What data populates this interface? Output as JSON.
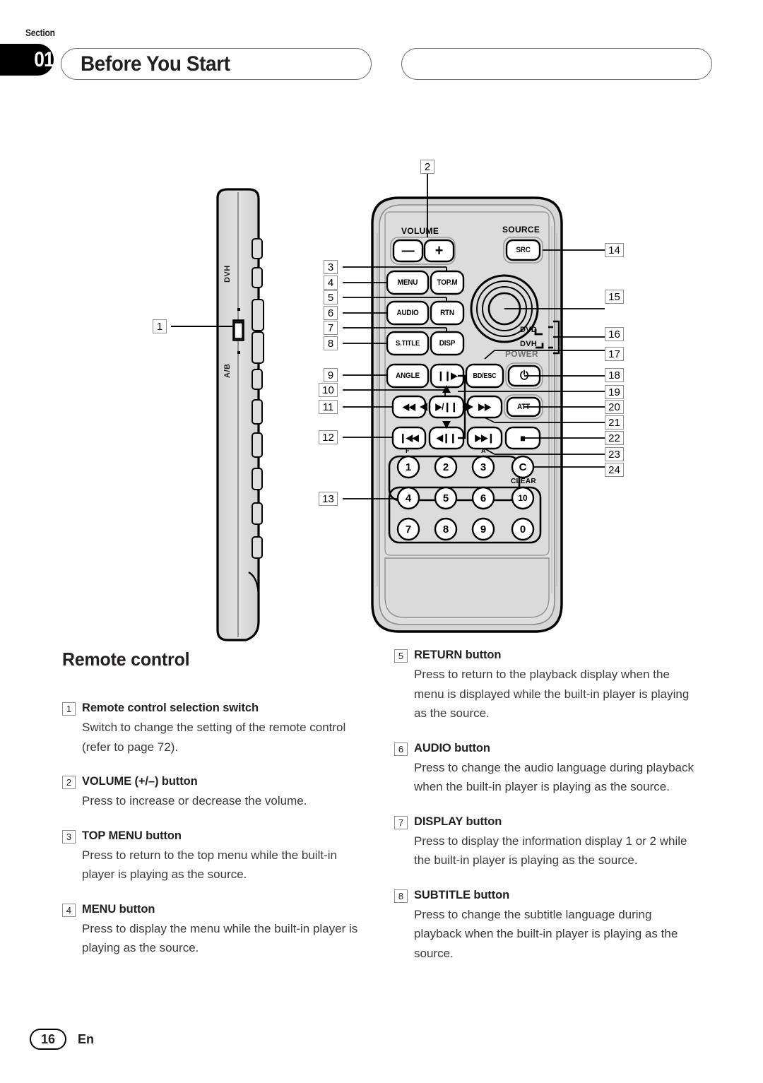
{
  "header": {
    "section_word": "Section",
    "section_number": "01",
    "title": "Before You Start"
  },
  "footer": {
    "page_number": "16",
    "language": "En"
  },
  "diagram": {
    "side_view": {
      "switch_top_label": "DVH",
      "switch_bottom_label": "A/B",
      "callout": "1"
    },
    "remote": {
      "group_labels": {
        "volume": "VOLUME",
        "source": "SOURCE",
        "power": "POWER",
        "clear": "CLEAR",
        "dvd": "DVD",
        "dvh": "DVH",
        "fwd_mark": "F",
        "rev_mark": "A"
      },
      "buttons": [
        {
          "id": "vol-minus",
          "label": "—"
        },
        {
          "id": "vol-plus",
          "label": "+"
        },
        {
          "id": "src",
          "label": "SRC"
        },
        {
          "id": "menu",
          "label": "MENU"
        },
        {
          "id": "top-menu",
          "label": "TOP.M"
        },
        {
          "id": "audio",
          "label": "AUDIO"
        },
        {
          "id": "rtn",
          "label": "RTN"
        },
        {
          "id": "s-title",
          "label": "S.TITLE"
        },
        {
          "id": "disp",
          "label": "DISP"
        },
        {
          "id": "angle",
          "label": "ANGLE"
        },
        {
          "id": "frame-adv",
          "label": "❙❙▶"
        },
        {
          "id": "bd-esc",
          "label": "BD/ESC"
        },
        {
          "id": "power",
          "label": "⏻"
        },
        {
          "id": "rewind",
          "label": "◀◀"
        },
        {
          "id": "play-pause",
          "label": "▶/❙❙"
        },
        {
          "id": "fast-forward",
          "label": "▶▶"
        },
        {
          "id": "att",
          "label": "ATT"
        },
        {
          "id": "prev-track",
          "label": "❙◀◀"
        },
        {
          "id": "slow-rev",
          "label": "◀❙❙"
        },
        {
          "id": "next-track",
          "label": "▶▶❙"
        },
        {
          "id": "stop",
          "label": "■"
        },
        {
          "id": "clear",
          "label": "C"
        }
      ],
      "keypad": [
        "1",
        "2",
        "3",
        "4",
        "5",
        "6",
        "7",
        "8",
        "9",
        "10",
        "0"
      ]
    },
    "callouts": [
      "1",
      "2",
      "3",
      "4",
      "5",
      "6",
      "7",
      "8",
      "9",
      "10",
      "11",
      "12",
      "13",
      "14",
      "15",
      "16",
      "17",
      "18",
      "19",
      "20",
      "21",
      "22",
      "23",
      "24"
    ]
  },
  "content": {
    "section_heading": "Remote control",
    "left_items": [
      {
        "num": "1",
        "title": "Remote control selection switch",
        "body": "Switch to change the setting of the remote control (refer to page 72)."
      },
      {
        "num": "2",
        "title": "VOLUME (+/–) button",
        "body": "Press to increase or decrease the volume."
      },
      {
        "num": "3",
        "title": "TOP MENU button",
        "body": "Press to return to the top menu while the built-in player is playing as the source."
      },
      {
        "num": "4",
        "title": "MENU button",
        "body": "Press to display the menu while the built-in player is playing as the source."
      }
    ],
    "right_items": [
      {
        "num": "5",
        "title": "RETURN button",
        "body": "Press to return to the playback display when the menu is displayed while the built-in player is playing as the source."
      },
      {
        "num": "6",
        "title": "AUDIO button",
        "body": "Press to change the audio language during playback when the built-in player is playing as the source."
      },
      {
        "num": "7",
        "title": "DISPLAY button",
        "body": "Press to display the information display 1 or 2 while the built-in player is playing as the source."
      },
      {
        "num": "8",
        "title": "SUBTITLE button",
        "body": "Press to change the subtitle language during playback when the built-in player is playing as the source."
      }
    ]
  },
  "colors": {
    "ink": "#231f20",
    "body_text": "#3a3a3c",
    "rule": "#6d6e71",
    "device_fill": "#d9d9d9",
    "device_fill_light": "#e6e6e6"
  }
}
